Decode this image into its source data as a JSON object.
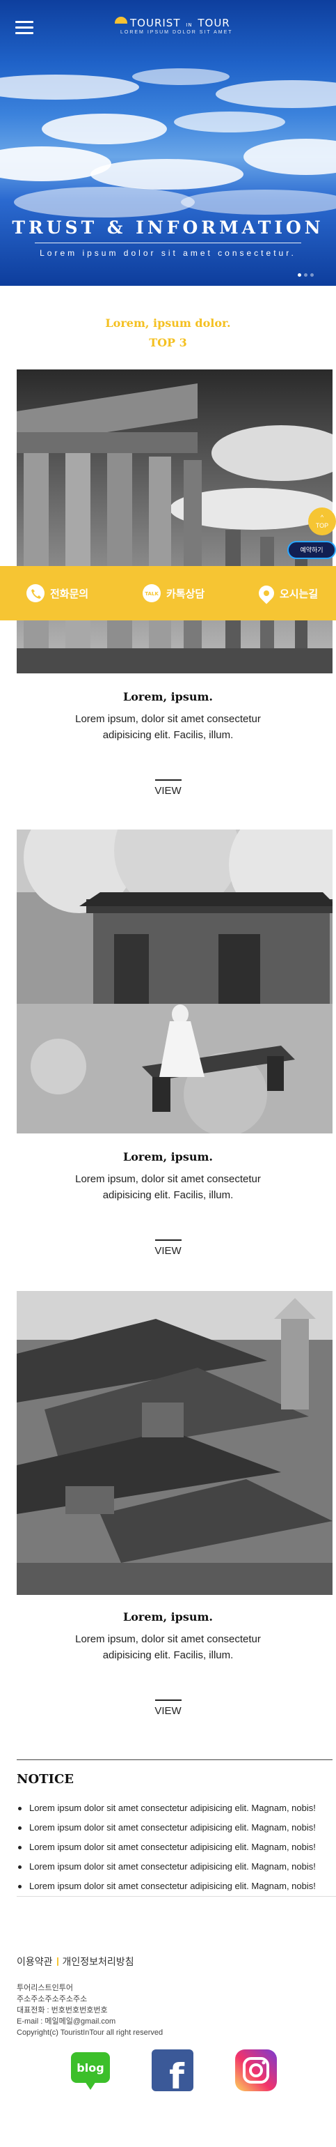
{
  "header": {
    "logo_text": "TOURIST",
    "logo_connector": "IN",
    "logo_text2": "TOUR",
    "logo_tagline": "LOREM IPSUM DOLOR SIT AMET"
  },
  "hero": {
    "title": "TRUST & INFORMATION",
    "subtitle": "Lorem ipsum dolor sit amet consectetur."
  },
  "section": {
    "heading_line1": "Lorem, ipsum dolor.",
    "heading_line2": "TOP 3"
  },
  "cards": [
    {
      "title": "Lorem, ipsum.",
      "description": "Lorem ipsum, dolor sit amet consectetur adipisicing elit. Facilis, illum.",
      "view_label": "VIEW"
    },
    {
      "title": "Lorem, ipsum.",
      "description": "Lorem ipsum, dolor sit amet consectetur adipisicing elit. Facilis, illum.",
      "view_label": "VIEW"
    },
    {
      "title": "Lorem, ipsum.",
      "description": "Lorem ipsum, dolor sit amet consectetur adipisicing elit. Facilis, illum.",
      "view_label": "VIEW"
    }
  ],
  "contact_bar": {
    "phone_label": "전화문의",
    "kakao_label": "카톡상담",
    "location_label": "오시는길",
    "phone_icon": "phone-icon",
    "kakao_icon": "chat-bubble-icon",
    "location_icon": "map-pin-icon"
  },
  "floating": {
    "top_arrow": "^",
    "top_label": "TOP",
    "reserve_label": "예약하기"
  },
  "notice": {
    "title": "NOTICE",
    "items": [
      "Lorem ipsum dolor sit amet consectetur adipisicing elit. Magnam, nobis!",
      "Lorem ipsum dolor sit amet consectetur adipisicing elit. Magnam, nobis!",
      "Lorem ipsum dolor sit amet consectetur adipisicing elit. Magnam, nobis!",
      "Lorem ipsum dolor sit amet consectetur adipisicing elit. Magnam, nobis!",
      "Lorem ipsum dolor sit amet consectetur adipisicing elit. Magnam, nobis!"
    ]
  },
  "footer": {
    "terms_link": "이용약관",
    "privacy_link": "개인정보처리방침",
    "company": "투어리스트인투어",
    "address": "주소주소주소주소주소",
    "phone": "대표전화 : 번호번호번호번호",
    "email": "E-mail : 메일메일@gmail.com",
    "copyright": "Copyright(c) TouristInTour all right reserved",
    "social": {
      "blog_label": "blog",
      "facebook_label": "f"
    }
  },
  "colors": {
    "accent_yellow": "#f6c533",
    "hero_blue": "#1f62c8",
    "reserve_navy": "#111f52"
  }
}
